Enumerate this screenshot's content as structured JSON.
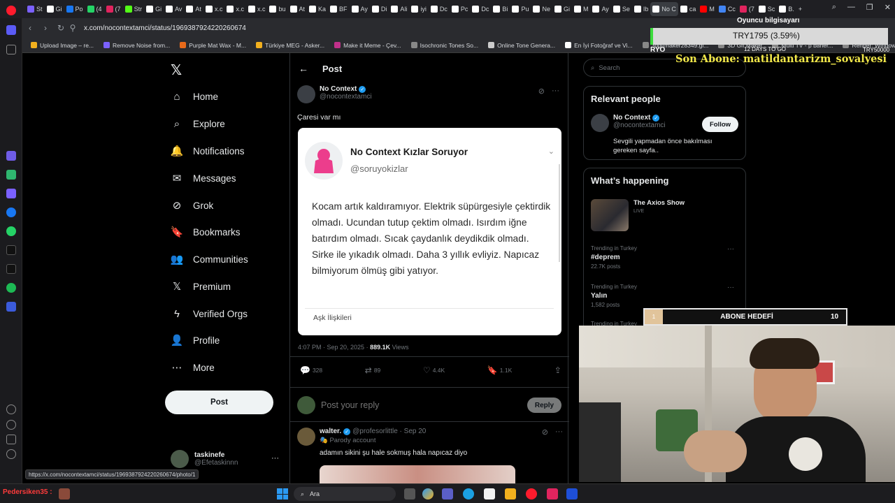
{
  "browser": {
    "tabs": [
      {
        "label": "St",
        "color": "#7b61ff"
      },
      {
        "label": "Gi",
        "color": "#ffffff"
      },
      {
        "label": "Po",
        "color": "#1877f2"
      },
      {
        "label": "(4",
        "color": "#25d366"
      },
      {
        "label": "(7",
        "color": "#e0245e"
      },
      {
        "label": "Str",
        "color": "#53fc18"
      },
      {
        "label": "Gi",
        "color": "#ffffff"
      },
      {
        "label": "Av",
        "color": "#ffffff"
      },
      {
        "label": "At",
        "color": "#ffffff"
      },
      {
        "label": "x.c",
        "color": "#ffffff"
      },
      {
        "label": "x.c",
        "color": "#ffffff"
      },
      {
        "label": "x.c",
        "color": "#ffffff"
      },
      {
        "label": "bu",
        "color": "#ffffff"
      },
      {
        "label": "At",
        "color": "#ffffff"
      },
      {
        "label": "Ka",
        "color": "#ffffff"
      },
      {
        "label": "BF",
        "color": "#ffffff"
      },
      {
        "label": "Ay",
        "color": "#ffffff"
      },
      {
        "label": "Di",
        "color": "#ffffff"
      },
      {
        "label": "Ali",
        "color": "#ffffff"
      },
      {
        "label": "iyi",
        "color": "#ffffff"
      },
      {
        "label": "Dc",
        "color": "#ffffff"
      },
      {
        "label": "Pc",
        "color": "#ffffff"
      },
      {
        "label": "Dc",
        "color": "#ffffff"
      },
      {
        "label": "Bi",
        "color": "#ffffff"
      },
      {
        "label": "Pu",
        "color": "#ffffff"
      },
      {
        "label": "Ne",
        "color": "#ffffff"
      },
      {
        "label": "Gi",
        "color": "#ffffff"
      },
      {
        "label": "M",
        "color": "#ffffff"
      },
      {
        "label": "Ay",
        "color": "#ffffff"
      },
      {
        "label": "Se",
        "color": "#ffffff"
      },
      {
        "label": "Ib",
        "color": "#ffffff"
      },
      {
        "label": "No C",
        "color": "#ffffff"
      },
      {
        "label": "ca",
        "color": "#ffffff"
      },
      {
        "label": "M",
        "color": "#ff0000"
      },
      {
        "label": "Cc",
        "color": "#4285f4"
      },
      {
        "label": "(7",
        "color": "#e0245e"
      },
      {
        "label": "Sc",
        "color": "#ffffff"
      },
      {
        "label": "B.",
        "color": "#ffffff"
      }
    ],
    "active_tab_index": 31,
    "new_tab": "+",
    "url": "x.com/nocontextamci/status/1969387924220260674",
    "bookmarks": [
      {
        "label": "Upload Image – re...",
        "color": "#f2b01e"
      },
      {
        "label": "Remove Noise from...",
        "color": "#7b61ff"
      },
      {
        "label": "Purple Mat Wax - M...",
        "color": "#e86a1a"
      },
      {
        "label": "Türkiye MEG - Asker...",
        "color": "#f2b01e"
      },
      {
        "label": "Make it Meme - Çev...",
        "color": "#c0308a"
      },
      {
        "label": "Isochronic Tones So...",
        "color": "#888888"
      },
      {
        "label": "Online Tone Genera...",
        "color": "#cccccc"
      },
      {
        "label": "En İyi Fotoğraf ve Vi...",
        "color": "#ffffff"
      },
      {
        "label": "3dgifmaker28349.gi...",
        "color": "#888888"
      },
      {
        "label": "3D Gif Maker",
        "color": "#888888"
      },
      {
        "label": "Multi TV - p baher...",
        "color": "#888888"
      },
      {
        "label": "Rehber: Windows 1...",
        "color": "#888888"
      }
    ],
    "status_link": "https://x.com/nocontextamci/status/1969387924220260674/photo/1"
  },
  "nav": {
    "logo": "𝕏",
    "items": [
      {
        "label": "Home",
        "icon": "⌂"
      },
      {
        "label": "Explore",
        "icon": "⌕"
      },
      {
        "label": "Notifications",
        "icon": "🔔"
      },
      {
        "label": "Messages",
        "icon": "✉"
      },
      {
        "label": "Grok",
        "icon": "⊘"
      },
      {
        "label": "Bookmarks",
        "icon": "🔖"
      },
      {
        "label": "Communities",
        "icon": "👥"
      },
      {
        "label": "Premium",
        "icon": "𝕏"
      },
      {
        "label": "Verified Orgs",
        "icon": "ϟ"
      },
      {
        "label": "Profile",
        "icon": "👤"
      },
      {
        "label": "More",
        "icon": "⋯"
      }
    ],
    "post_button": "Post",
    "account": {
      "name": "taskinefe",
      "handle": "@Efetaskinnn",
      "more": "···"
    }
  },
  "main": {
    "title": "Post",
    "back": "←",
    "author": {
      "name": "No Context",
      "handle": "@nocontextamci"
    },
    "text": "Çaresi var mı",
    "card": {
      "name": "No Context Kızlar Soruyor",
      "handle": "@soruyokizlar",
      "body": "Kocam artık kaldıramıyor. Elektrik süpürgesiyle çektirdik olmadı. Ucundan tutup çektim olmadı. Isırdım iğne batırdım olmadı. Sıcak çaydanlık deydikdik olmadı. Sirke ile yıkadık olmadı. Daha 3 yıllık evliyiz. Napıcaz bilmiyorum ölmüş gibi yatıyor.",
      "tag": "Aşk İlişkileri"
    },
    "meta": {
      "time": "4:07 PM · Sep 20, 2025 · ",
      "views": "889.1K",
      "views_label": " Views"
    },
    "stats": {
      "replies": "328",
      "reposts": "89",
      "likes": "4.4K",
      "bookmarks": "1.1K"
    },
    "reply_placeholder": "Post your reply",
    "reply_button": "Reply",
    "reply_tweet": {
      "name": "walter.",
      "handle_date": "@profesorlittle · Sep 20",
      "parody": "Parody account",
      "text": "adamın sikini şu hale sokmuş hala napıcaz diyo"
    }
  },
  "right": {
    "search_placeholder": "Search",
    "relevant_title": "Relevant people",
    "relevant": {
      "name": "No Context",
      "handle": "@nocontextamci",
      "desc": "Sevgili yapmadan önce bakılması gereken sayfa..",
      "follow": "Follow"
    },
    "happening_title": "What’s happening",
    "live": {
      "title": "The Axios Show",
      "badge": "LIVE"
    },
    "trends": [
      {
        "context": "Trending in Turkey",
        "topic": "#deprem",
        "posts": "22.7K posts"
      },
      {
        "context": "Trending in Turkey",
        "topic": "Yalın",
        "posts": "1,582 posts"
      },
      {
        "context": "Trending in Turkey",
        "topic": "",
        "posts": ""
      }
    ]
  },
  "overlay": {
    "player_label": "Oyuncu bilgisayarı",
    "goal_text": "TRY1795 (3.59%)",
    "ryo": "RYO",
    "days": "12 DAYS TO GO",
    "target": "TRY50000",
    "last_sub": "Son Abone: matildantarizm_sovalyesi",
    "sub_goal_start": "1",
    "sub_goal_label": "ABONE HEDEFİ",
    "sub_goal_end": "10"
  },
  "taskbar": {
    "streamer": "Pedersiken35 :",
    "search_label": "Ara"
  }
}
